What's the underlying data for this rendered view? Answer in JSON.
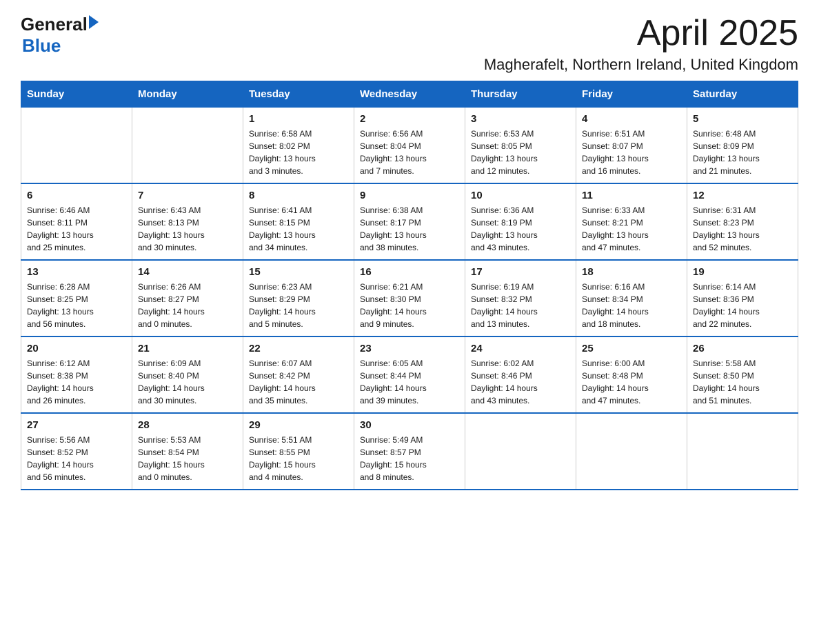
{
  "header": {
    "logo_general": "General",
    "logo_blue": "Blue",
    "month_title": "April 2025",
    "location": "Magherafelt, Northern Ireland, United Kingdom"
  },
  "weekdays": [
    "Sunday",
    "Monday",
    "Tuesday",
    "Wednesday",
    "Thursday",
    "Friday",
    "Saturday"
  ],
  "weeks": [
    [
      {
        "day": "",
        "info": ""
      },
      {
        "day": "",
        "info": ""
      },
      {
        "day": "1",
        "info": "Sunrise: 6:58 AM\nSunset: 8:02 PM\nDaylight: 13 hours\nand 3 minutes."
      },
      {
        "day": "2",
        "info": "Sunrise: 6:56 AM\nSunset: 8:04 PM\nDaylight: 13 hours\nand 7 minutes."
      },
      {
        "day": "3",
        "info": "Sunrise: 6:53 AM\nSunset: 8:05 PM\nDaylight: 13 hours\nand 12 minutes."
      },
      {
        "day": "4",
        "info": "Sunrise: 6:51 AM\nSunset: 8:07 PM\nDaylight: 13 hours\nand 16 minutes."
      },
      {
        "day": "5",
        "info": "Sunrise: 6:48 AM\nSunset: 8:09 PM\nDaylight: 13 hours\nand 21 minutes."
      }
    ],
    [
      {
        "day": "6",
        "info": "Sunrise: 6:46 AM\nSunset: 8:11 PM\nDaylight: 13 hours\nand 25 minutes."
      },
      {
        "day": "7",
        "info": "Sunrise: 6:43 AM\nSunset: 8:13 PM\nDaylight: 13 hours\nand 30 minutes."
      },
      {
        "day": "8",
        "info": "Sunrise: 6:41 AM\nSunset: 8:15 PM\nDaylight: 13 hours\nand 34 minutes."
      },
      {
        "day": "9",
        "info": "Sunrise: 6:38 AM\nSunset: 8:17 PM\nDaylight: 13 hours\nand 38 minutes."
      },
      {
        "day": "10",
        "info": "Sunrise: 6:36 AM\nSunset: 8:19 PM\nDaylight: 13 hours\nand 43 minutes."
      },
      {
        "day": "11",
        "info": "Sunrise: 6:33 AM\nSunset: 8:21 PM\nDaylight: 13 hours\nand 47 minutes."
      },
      {
        "day": "12",
        "info": "Sunrise: 6:31 AM\nSunset: 8:23 PM\nDaylight: 13 hours\nand 52 minutes."
      }
    ],
    [
      {
        "day": "13",
        "info": "Sunrise: 6:28 AM\nSunset: 8:25 PM\nDaylight: 13 hours\nand 56 minutes."
      },
      {
        "day": "14",
        "info": "Sunrise: 6:26 AM\nSunset: 8:27 PM\nDaylight: 14 hours\nand 0 minutes."
      },
      {
        "day": "15",
        "info": "Sunrise: 6:23 AM\nSunset: 8:29 PM\nDaylight: 14 hours\nand 5 minutes."
      },
      {
        "day": "16",
        "info": "Sunrise: 6:21 AM\nSunset: 8:30 PM\nDaylight: 14 hours\nand 9 minutes."
      },
      {
        "day": "17",
        "info": "Sunrise: 6:19 AM\nSunset: 8:32 PM\nDaylight: 14 hours\nand 13 minutes."
      },
      {
        "day": "18",
        "info": "Sunrise: 6:16 AM\nSunset: 8:34 PM\nDaylight: 14 hours\nand 18 minutes."
      },
      {
        "day": "19",
        "info": "Sunrise: 6:14 AM\nSunset: 8:36 PM\nDaylight: 14 hours\nand 22 minutes."
      }
    ],
    [
      {
        "day": "20",
        "info": "Sunrise: 6:12 AM\nSunset: 8:38 PM\nDaylight: 14 hours\nand 26 minutes."
      },
      {
        "day": "21",
        "info": "Sunrise: 6:09 AM\nSunset: 8:40 PM\nDaylight: 14 hours\nand 30 minutes."
      },
      {
        "day": "22",
        "info": "Sunrise: 6:07 AM\nSunset: 8:42 PM\nDaylight: 14 hours\nand 35 minutes."
      },
      {
        "day": "23",
        "info": "Sunrise: 6:05 AM\nSunset: 8:44 PM\nDaylight: 14 hours\nand 39 minutes."
      },
      {
        "day": "24",
        "info": "Sunrise: 6:02 AM\nSunset: 8:46 PM\nDaylight: 14 hours\nand 43 minutes."
      },
      {
        "day": "25",
        "info": "Sunrise: 6:00 AM\nSunset: 8:48 PM\nDaylight: 14 hours\nand 47 minutes."
      },
      {
        "day": "26",
        "info": "Sunrise: 5:58 AM\nSunset: 8:50 PM\nDaylight: 14 hours\nand 51 minutes."
      }
    ],
    [
      {
        "day": "27",
        "info": "Sunrise: 5:56 AM\nSunset: 8:52 PM\nDaylight: 14 hours\nand 56 minutes."
      },
      {
        "day": "28",
        "info": "Sunrise: 5:53 AM\nSunset: 8:54 PM\nDaylight: 15 hours\nand 0 minutes."
      },
      {
        "day": "29",
        "info": "Sunrise: 5:51 AM\nSunset: 8:55 PM\nDaylight: 15 hours\nand 4 minutes."
      },
      {
        "day": "30",
        "info": "Sunrise: 5:49 AM\nSunset: 8:57 PM\nDaylight: 15 hours\nand 8 minutes."
      },
      {
        "day": "",
        "info": ""
      },
      {
        "day": "",
        "info": ""
      },
      {
        "day": "",
        "info": ""
      }
    ]
  ]
}
